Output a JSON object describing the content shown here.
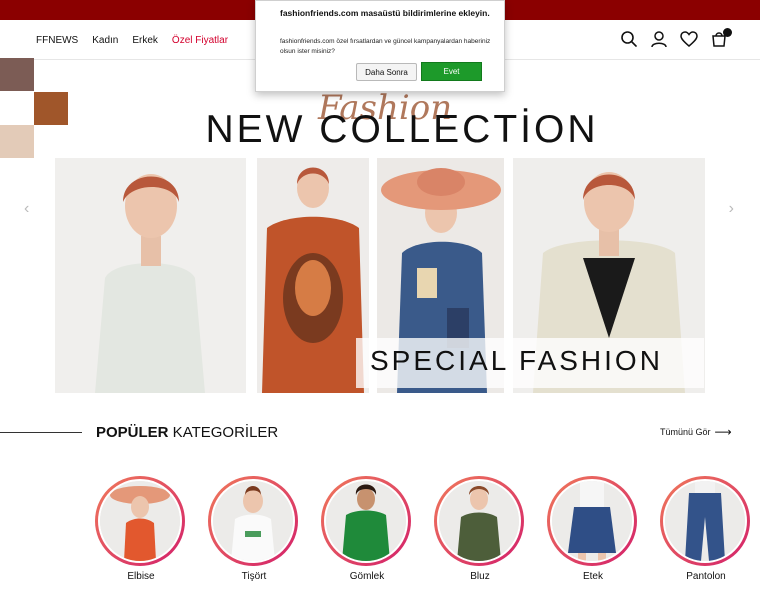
{
  "header": {
    "nav": [
      {
        "label": "FFNEWS"
      },
      {
        "label": "Kadın"
      },
      {
        "label": "Erkek"
      },
      {
        "label": "Özel Fiyatlar"
      }
    ],
    "special_color": "#d3002d",
    "icons": [
      "search-icon",
      "user-icon",
      "heart-icon",
      "cart-icon"
    ]
  },
  "hero": {
    "script": "Fashion",
    "title": "NEW COLLECTİON",
    "banner": "SPECIAL FASHION",
    "prev": "‹",
    "next": "›"
  },
  "swatch_colors": [
    "#7c5c55",
    "#a0562a",
    "#e3cbb8"
  ],
  "section": {
    "title_bold": "POPÜLER",
    "title_rest": " KATEGORİLER",
    "see_all": "Tümünü Gör",
    "see_all_arrow": "⟶"
  },
  "categories": [
    {
      "label": "Elbise"
    },
    {
      "label": "Tişört"
    },
    {
      "label": "Gömlek"
    },
    {
      "label": "Bluz"
    },
    {
      "label": "Etek"
    },
    {
      "label": "Pantolon"
    }
  ],
  "popup": {
    "title": "fashionfriends.com masaüstü bildirimlerine ekleyin.",
    "body": "fashionfriends.com özel fırsatlardan ve güncel kampanyalardan haberiniz olsun ister misiniz?",
    "later": "Daha Sonra",
    "yes": "Evet",
    "yes_color": "#1d9a2a"
  }
}
